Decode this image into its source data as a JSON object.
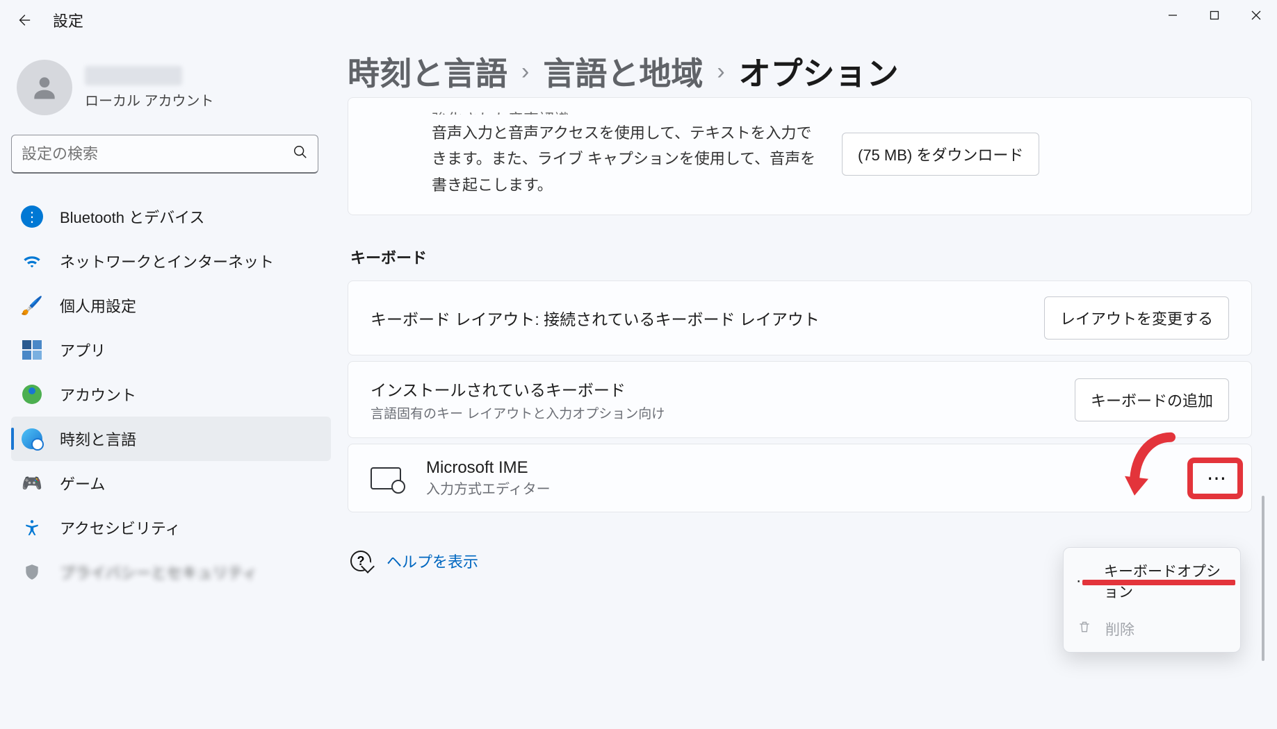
{
  "app_title": "設定",
  "account": {
    "type": "ローカル アカウント"
  },
  "search": {
    "placeholder": "設定の検索"
  },
  "sidebar": {
    "items": [
      {
        "label": "Bluetooth とデバイス"
      },
      {
        "label": "ネットワークとインターネット"
      },
      {
        "label": "個人用設定"
      },
      {
        "label": "アプリ"
      },
      {
        "label": "アカウント"
      },
      {
        "label": "時刻と言語"
      },
      {
        "label": "ゲーム"
      },
      {
        "label": "アクセシビリティ"
      },
      {
        "label": "プライバシーとセキュリティ"
      }
    ]
  },
  "breadcrumb": {
    "crumb1": "時刻と言語",
    "crumb2": "言語と地域",
    "crumb3": "オプション"
  },
  "speech": {
    "truncated_title": "強化された音声認識",
    "desc": "音声入力と音声アクセスを使用して、テキストを入力できます。また、ライブ キャプションを使用して、音声を書き起こします。",
    "button": "(75 MB) をダウンロード"
  },
  "keyboard": {
    "section_title": "キーボード",
    "layout_row": {
      "title": "キーボード レイアウト: 接続されているキーボード レイアウト",
      "button": "レイアウトを変更する"
    },
    "installed_row": {
      "title": "インストールされているキーボード",
      "sub": "言語固有のキー レイアウトと入力オプション向け",
      "button": "キーボードの追加"
    },
    "ime": {
      "name": "Microsoft IME",
      "sub": "入力方式エディター"
    }
  },
  "context_menu": {
    "options": "キーボードオプション",
    "delete": "削除"
  },
  "help": {
    "label": "ヘルプを表示"
  }
}
